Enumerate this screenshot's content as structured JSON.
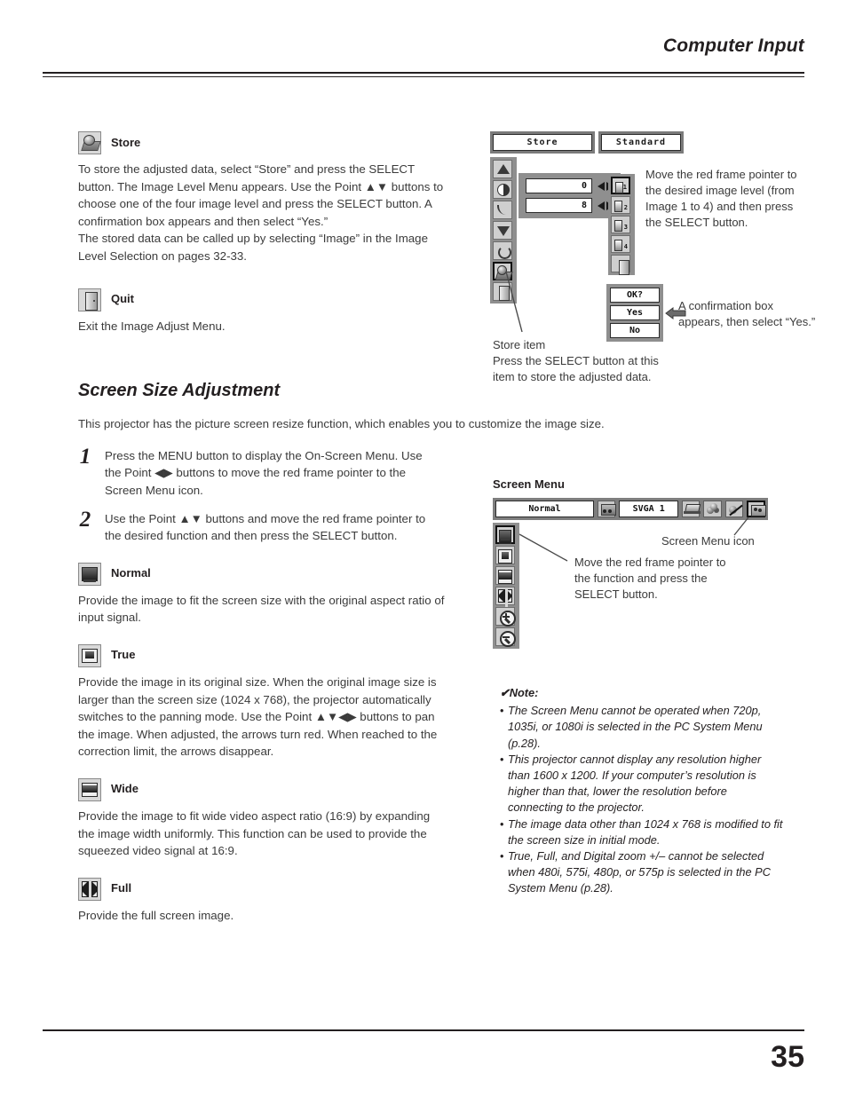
{
  "header": {
    "title": "Computer Input"
  },
  "footer": {
    "page_number": "35"
  },
  "store_section": {
    "icon": "store-icon",
    "title": "Store",
    "body": "To store the adjusted data, select “Store” and press the SELECT button. The Image Level Menu appears. Use the Point ▲▼ buttons to choose one of the four image level and press the SELECT button. A confirmation box appears and then select “Yes.”\nThe stored data can be called up by selecting “Image” in the Image Level Selection on pages 32-33."
  },
  "quit_section": {
    "icon": "quit-icon",
    "title": "Quit",
    "body": "Exit the Image Adjust Menu."
  },
  "image_adjust_osd": {
    "tabs": [
      "Store",
      "Standard"
    ],
    "sidebar_icons": [
      "brightness-icon",
      "contrast-icon",
      "gamma-icon",
      "down-arrow-icon",
      "reset-icon",
      "store-icon",
      "quit-icon"
    ],
    "selected_sidebar_index": 5,
    "values": [
      "0",
      "8"
    ],
    "level_icons": [
      "image-1-icon",
      "image-2-icon",
      "image-3-icon",
      "image-4-icon",
      "quit-icon"
    ],
    "level_labels": [
      "1",
      "2",
      "3",
      "4",
      ""
    ],
    "selected_level_index": 0,
    "confirm_box": [
      "OK?",
      "Yes",
      "No"
    ],
    "callout_level": "Move the red frame pointer to the desired image level (from Image 1 to 4) and then press the SELECT button.",
    "callout_confirm": "A confirmation box appears, then select “Yes.”",
    "callout_store": "Store item\nPress the SELECT button at this item to store the adjusted data."
  },
  "screen_size": {
    "heading": "Screen Size Adjustment",
    "intro": "This projector has the picture screen resize function, which enables you to customize the image size.",
    "steps": [
      {
        "num": "1",
        "text": "Press the MENU button to display the On-Screen Menu. Use the Point ◀▶ buttons to move the red frame pointer to the Screen Menu icon."
      },
      {
        "num": "2",
        "text": "Use the Point ▲▼ buttons and move the red frame pointer to the desired function and then press the SELECT button."
      }
    ],
    "items": [
      {
        "icon": "normal-screen-icon",
        "title": "Normal",
        "body": "Provide the image to fit the screen size with the original aspect ratio of input signal."
      },
      {
        "icon": "true-screen-icon",
        "title": "True",
        "body": "Provide the image in its original size. When the original image size is larger than the screen size (1024 x 768), the projector automatically switches to the panning mode. Use the Point ▲▼◀▶ buttons to pan the image. When adjusted, the arrows turn red. When reached to the correction limit, the arrows disappear."
      },
      {
        "icon": "wide-screen-icon",
        "title": "Wide",
        "body": "Provide the image to fit wide video aspect ratio (16:9) by expanding the image width uniformly. This function can be used to provide the squeezed video signal at 16:9."
      },
      {
        "icon": "full-screen-icon",
        "title": "Full",
        "body": "Provide the full screen image."
      }
    ]
  },
  "screen_menu": {
    "caption": "Screen Menu",
    "selected_mode": "Normal",
    "system_value": "SVGA 1",
    "bar_icons": [
      "system-icon",
      "laptop-icon",
      "color-balls-icon",
      "sound-mute-icon",
      "screen-icon"
    ],
    "selected_bar_icon": "screen-icon",
    "side_icons": [
      "normal-screen-icon",
      "true-screen-icon",
      "wide-screen-icon",
      "full-screen-icon",
      "digital-zoom-in-icon",
      "digital-zoom-out-icon"
    ],
    "selected_side_index": 0,
    "callout_icon": "Screen Menu icon",
    "callout_function": "Move the red frame pointer to the function and press the SELECT button."
  },
  "note": {
    "title": "Note:",
    "check": "✔",
    "items": [
      "The Screen Menu cannot be operated when 720p, 1035i, or 1080i is selected in the PC System Menu (p.28).",
      "This projector cannot display any resolution higher than 1600 x 1200. If your computer’s resolution is higher than that, lower the resolution before connecting to the projector.",
      "The image data other than 1024 x 768 is modified to fit the screen size in initial mode.",
      "True, Full, and Digital zoom +/– cannot be selected when 480i, 575i, 480p, or 575p is selected in the PC System Menu (p.28)."
    ]
  }
}
